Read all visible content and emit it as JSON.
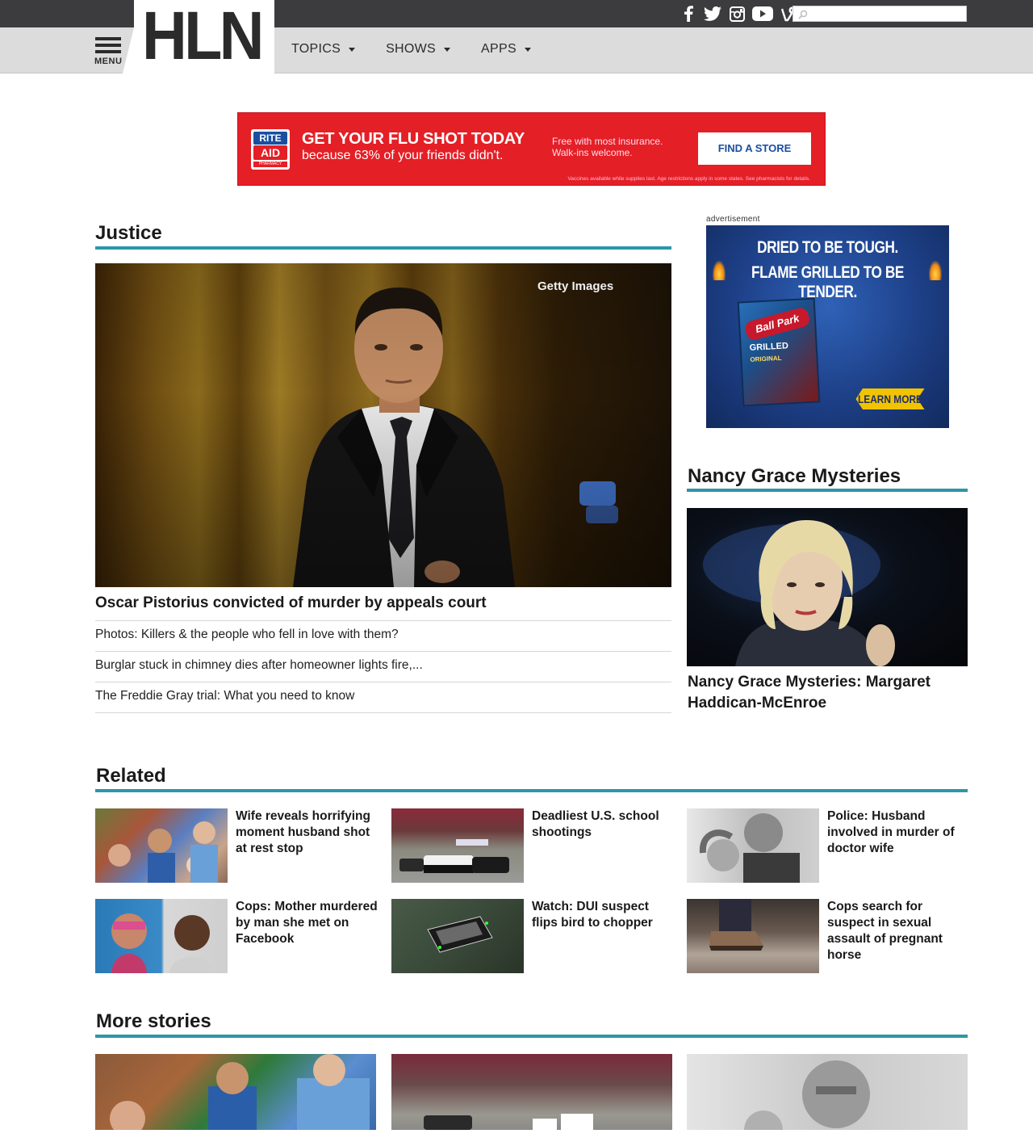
{
  "header": {
    "logo": "HLN",
    "menu_label": "MENU",
    "nav": [
      {
        "label": "TOPICS"
      },
      {
        "label": "SHOWS"
      },
      {
        "label": "APPS"
      }
    ],
    "social_icons": [
      "facebook-icon",
      "twitter-icon",
      "instagram-icon",
      "youtube-icon",
      "vine-icon"
    ],
    "search": {
      "value": "",
      "placeholder": ""
    }
  },
  "banner_ad": {
    "brand_top": "RITE",
    "brand_bottom": "AID",
    "brand_sub": "PHARMACY",
    "headline": "GET YOUR FLU SHOT TODAY",
    "subline": "because 63% of your friends didn't.",
    "free_line1": "Free with most insurance.",
    "free_line2": "Walk-ins welcome.",
    "cta": "FIND A STORE",
    "fine_print": "Vaccines available while supplies last. Age restrictions apply in some states. See pharmacists for details.",
    "color": "#e41f26"
  },
  "justice": {
    "heading": "Justice",
    "image_credit": "Getty Images",
    "lead_title": "Oscar Pistorius convicted of murder by appeals court",
    "links": [
      "Photos: Killers & the people who fell in love with them?",
      "Burglar stuck in chimney dies after homeowner lights fire,...",
      "The Freddie Gray trial: What you need to know"
    ]
  },
  "side_ad": {
    "label": "advertisement",
    "line1": "DRIED TO BE TOUGH.",
    "line2": "FLAME GRILLED TO BE TENDER.",
    "bag_brand": "Ball Park",
    "bag_type": "GRILLED",
    "bag_flavor": "ORIGINAL",
    "cta": "LEARN MORE"
  },
  "nancy": {
    "heading": "Nancy Grace Mysteries",
    "title": "Nancy Grace Mysteries: Margaret Haddican-McEnroe"
  },
  "related": {
    "heading": "Related",
    "items": [
      {
        "caption": "Wife reveals horrifying moment husband shot at rest stop"
      },
      {
        "caption": "Deadliest U.S. school shootings"
      },
      {
        "caption": "Police: Husband involved in murder of doctor wife"
      },
      {
        "caption": "Cops: Mother murdered by man she met on Facebook"
      },
      {
        "caption": "Watch: DUI suspect flips bird to chopper"
      },
      {
        "caption": "Cops search for suspect in sexual assault of pregnant horse"
      }
    ]
  },
  "more": {
    "heading": "More stories"
  },
  "colors": {
    "accent": "#2e96a8",
    "topbar": "#3c3c3e",
    "navbar": "#dcdcdd"
  }
}
